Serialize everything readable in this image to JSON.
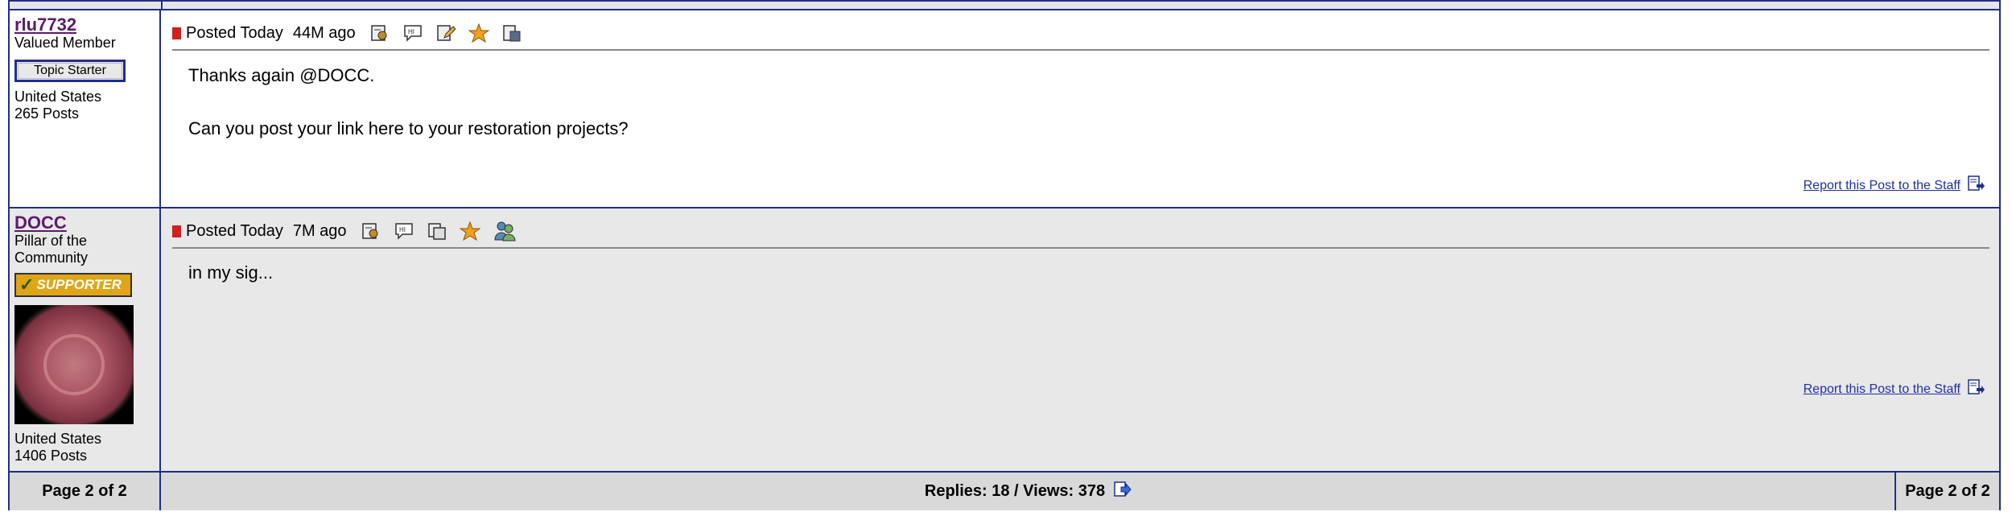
{
  "posts": [
    {
      "username": "rlu7732",
      "user_title": "Valued Member",
      "badge": "Topic Starter",
      "country": "United States",
      "post_count": "265 Posts",
      "posted": "Posted Today",
      "ago": "44M ago",
      "body_lines": [
        "Thanks again @DOCC.",
        "Can you post your link here to your restoration projects?"
      ],
      "report_label": "Report this Post to the Staff",
      "icons": [
        "profile-icon",
        "quote-icon",
        "edit-icon",
        "star-icon",
        "delete-icon"
      ]
    },
    {
      "username": "DOCC",
      "user_title": "Pillar of the Community",
      "badge": "SUPPORTER",
      "country": "United States",
      "post_count": "1406 Posts",
      "posted": "Posted Today",
      "ago": "7M ago",
      "body_lines": [
        "in my sig..."
      ],
      "report_label": "Report this Post to the Staff",
      "icons": [
        "profile-icon",
        "quote-icon",
        "copy-icon",
        "star-icon",
        "buddy-icon"
      ]
    }
  ],
  "footer": {
    "page_left": "Page 2 of 2",
    "replies_views": "Replies: 18 / Views: 378",
    "page_right": "Page 2 of 2"
  },
  "colors": {
    "border": "#1f2f8a",
    "username": "#5c1a6e",
    "link": "#1f2fa6",
    "marker": "#d21f1f",
    "supporter_bg": "#e0a516"
  }
}
